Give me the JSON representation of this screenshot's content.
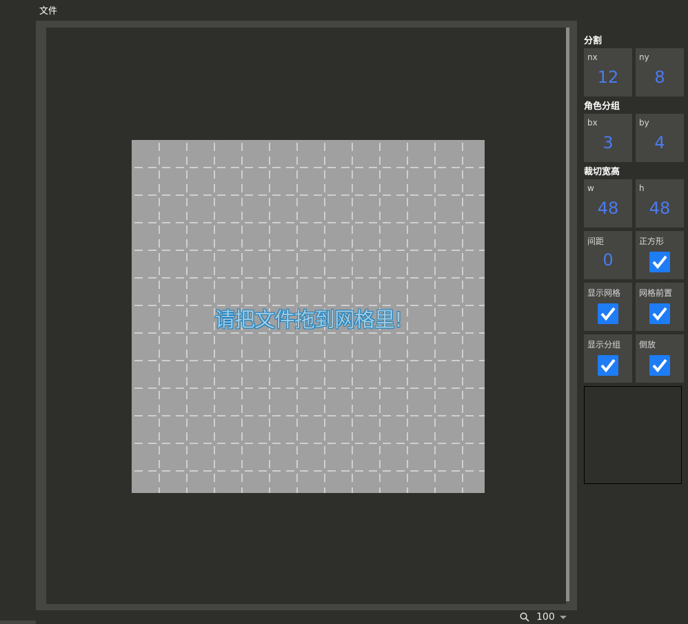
{
  "menubar": {
    "file_label": "文件"
  },
  "canvas": {
    "drop_hint": "请把文件拖到网格里!",
    "background": "#a0a0a0",
    "grid_line_color": "#ffffff",
    "grid_columns": 12,
    "grid_rows": 8
  },
  "statusbar": {
    "zoom_value": "100",
    "zoom_icon": "search-icon"
  },
  "panel": {
    "split": {
      "title": "分割",
      "nx_label": "nx",
      "nx_value": "12",
      "ny_label": "ny",
      "ny_value": "8"
    },
    "role_group": {
      "title": "角色分组",
      "bx_label": "bx",
      "bx_value": "3",
      "by_label": "by",
      "by_value": "4"
    },
    "crop_size": {
      "title": "裁切宽高",
      "w_label": "w",
      "w_value": "48",
      "h_label": "h",
      "h_value": "48"
    },
    "spacing_label": "间距",
    "spacing_value": "0",
    "square_label": "正方形",
    "square_checked": true,
    "show_grid_label": "显示网格",
    "show_grid_checked": true,
    "grid_front_label": "网格前置",
    "grid_front_checked": true,
    "show_group_label": "显示分组",
    "show_group_checked": true,
    "flip_label": "倒放",
    "flip_checked": true
  },
  "colors": {
    "accent_value": "#4a7cf0",
    "checkbox": "#1e7cf5",
    "panel_cell": "#454542",
    "background": "#2e2e2a"
  }
}
